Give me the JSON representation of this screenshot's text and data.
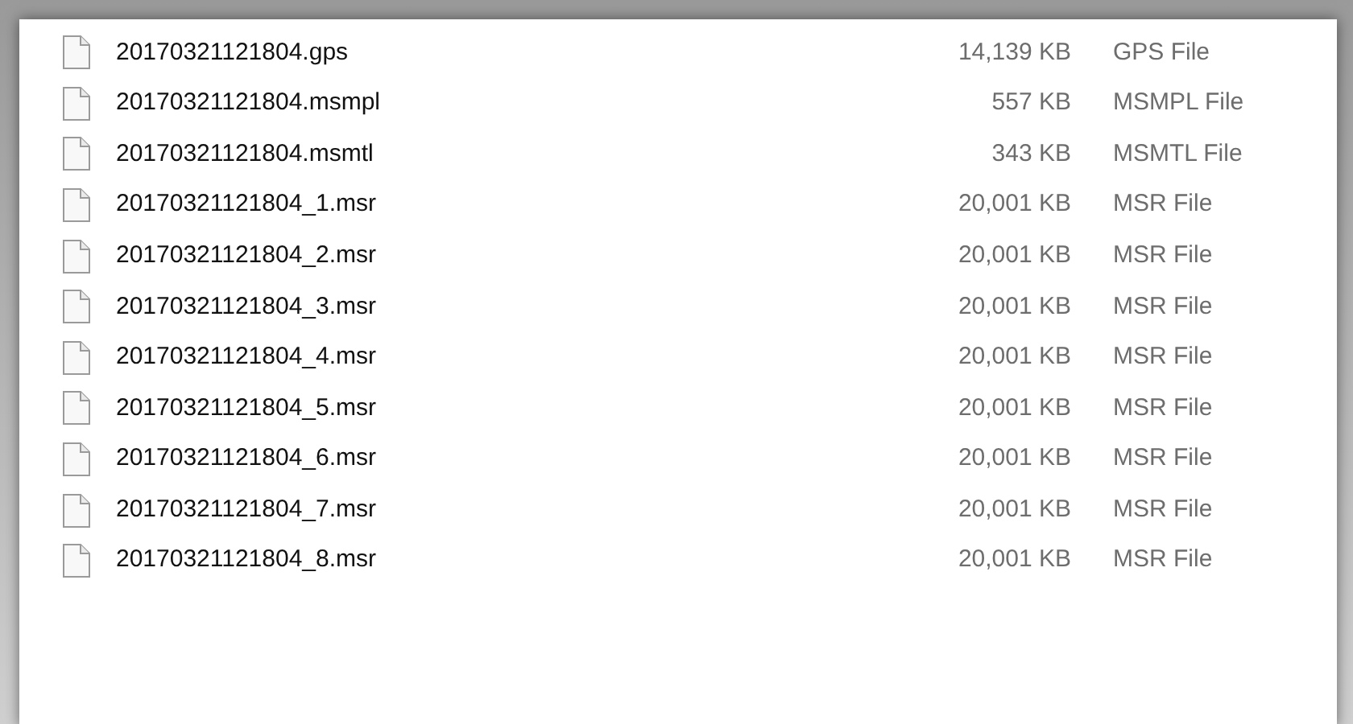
{
  "files": [
    {
      "name": "20170321121804.gps",
      "size": "14,139 KB",
      "type": "GPS File"
    },
    {
      "name": "20170321121804.msmpl",
      "size": "557 KB",
      "type": "MSMPL File"
    },
    {
      "name": "20170321121804.msmtl",
      "size": "343 KB",
      "type": "MSMTL File"
    },
    {
      "name": "20170321121804_1.msr",
      "size": "20,001 KB",
      "type": "MSR File"
    },
    {
      "name": "20170321121804_2.msr",
      "size": "20,001 KB",
      "type": "MSR File"
    },
    {
      "name": "20170321121804_3.msr",
      "size": "20,001 KB",
      "type": "MSR File"
    },
    {
      "name": "20170321121804_4.msr",
      "size": "20,001 KB",
      "type": "MSR File"
    },
    {
      "name": "20170321121804_5.msr",
      "size": "20,001 KB",
      "type": "MSR File"
    },
    {
      "name": "20170321121804_6.msr",
      "size": "20,001 KB",
      "type": "MSR File"
    },
    {
      "name": "20170321121804_7.msr",
      "size": "20,001 KB",
      "type": "MSR File"
    },
    {
      "name": "20170321121804_8.msr",
      "size": "20,001 KB",
      "type": "MSR File"
    }
  ]
}
